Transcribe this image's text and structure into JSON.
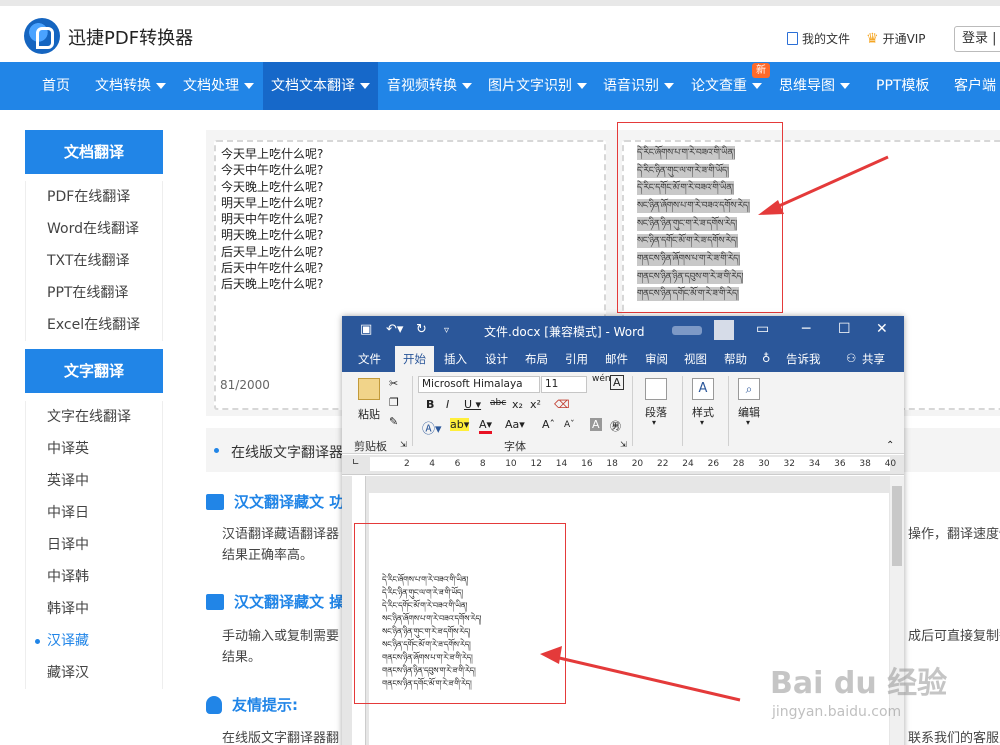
{
  "site": {
    "logo_text": "迅捷PDF转换器",
    "my_files": "我的文件",
    "vip": "开通VIP",
    "login": "登录 |"
  },
  "nav": {
    "items": [
      "首页",
      "文档转换",
      "文档处理",
      "文档文本翻译",
      "音视频转换",
      "图片文字识别",
      "语音识别",
      "论文查重",
      "思维导图",
      "PPT模板",
      "客户端"
    ],
    "new_badge": "新"
  },
  "sidebar": {
    "doc_head": "文档翻译",
    "doc_items": [
      "PDF在线翻译",
      "Word在线翻译",
      "TXT在线翻译",
      "PPT在线翻译",
      "Excel在线翻译"
    ],
    "text_head": "文字翻译",
    "text_items": [
      "文字在线翻译",
      "中译英",
      "英译中",
      "中译日",
      "日译中",
      "中译韩",
      "韩译中",
      "汉译藏",
      "藏译汉"
    ]
  },
  "translator": {
    "source_lines": [
      "今天早上吃什么呢?",
      "今天中午吃什么呢?",
      "今天晚上吃什么呢?",
      "明天早上吃什么呢?",
      "明天中午吃什么呢?",
      "明天晚上吃什么呢?",
      "后天早上吃什么呢?",
      "后天中午吃什么呢?",
      "后天晚上吃什么呢?"
    ],
    "counter": "81/2000",
    "result_lines": [
      "དེ་རིང་ཞོགས་པ་ག་རེ་བཟའ་གི་ཡིན།",
      "དེ་རིང་ཉིན་གུང་ལ་ག་རེ་ཟ་གི་ཡོད།",
      "དེ་རིང་དགོང་མོ་ག་རེ་བཟའ་གི་ཡིན།",
      "སང་ཉིན་ཞོགས་པ་ག་རེ་བཟའ་དགོས་རེད།",
      "སང་ཉིན་ཉིན་གུང་ག་རེ་ཟ་དགོས་རེད།",
      "སང་ཉིན་དགོང་མོ་ག་རེ་ཟ་དགོས་རེད།",
      "གནངས་ཉིན་ཞོགས་པ་ག་རེ་ཟ་གི་རེད།",
      "གནངས་ཉིན་ཉིན་དབུས་ག་རེ་ཟ་གི་རེད།",
      "གནངས་ཉིན་དགོང་མོ་ག་རེ་ཟ་གི་རེད།"
    ]
  },
  "article": {
    "bullet": "在线版文字翻译器",
    "sec1_title": "汉文翻译藏文 功",
    "sec1_p1": "汉语翻译藏语翻译器",
    "sec1_p1_right": "操作，翻译速度快",
    "sec1_p2": "结果正确率高。",
    "sec2_title": "汉文翻译藏文 操",
    "sec2_p1": "手动输入或复制需要",
    "sec2_p1_right": "成后可直接复制翻",
    "sec2_p2": "结果。",
    "sec3_title": "友情提示:",
    "sec3_p1": "在线版文字翻译器翻",
    "sec3_p1_right": "联系我们的客服人"
  },
  "word": {
    "title": "文件.docx [兼容模式] - Word",
    "tabs": [
      "文件",
      "开始",
      "插入",
      "设计",
      "布局",
      "引用",
      "邮件",
      "审阅",
      "视图",
      "帮助",
      "告诉我",
      "共享"
    ],
    "font_name": "Microsoft Himalaya",
    "font_size": "11",
    "paste": "粘贴",
    "clipboard": "剪贴板",
    "font_group": "字体",
    "paragraph": "段落",
    "styles": "样式",
    "editing": "编辑",
    "ruler": [
      "2",
      "4",
      "6",
      "8",
      "10",
      "12",
      "14",
      "16",
      "18",
      "20",
      "22",
      "24",
      "26",
      "28",
      "30",
      "32",
      "34",
      "36",
      "38",
      "40"
    ],
    "doc_lines": [
      "དེ་རིང་ཞོགས་པ་ག་རེ་བཟའ་གི་ཡིན།",
      "དེ་རིང་ཉིན་གུང་ལ་ག་རེ་ཟ་གི་ཡོད།",
      "དེ་རིང་དགོང་མོ་ག་རེ་བཟའ་གི་ཡིན།",
      "སང་ཉིན་ཞོགས་པ་ག་རེ་བཟའ་དགོས་རེད།",
      "སང་ཉིན་ཉིན་གུང་ག་རེ་ཟ་དགོས་རེད།",
      "སང་ཉིན་དགོང་མོ་ག་རེ་ཟ་དགོས་རེད།",
      "གནངས་ཉིན་ཞོགས་པ་ག་རེ་ཟ་གི་རེད།",
      "གནངས་ཉིན་ཉིན་དབུས་ག་རེ་ཟ་གི་རེད།",
      "གནངས་ཉིན་དགོང་མོ་ག་རེ་ཟ་གི་རེད།"
    ]
  },
  "watermark": {
    "main": "Bai du 经验",
    "sub": "jingyan.baidu.com"
  },
  "colors": {
    "brand_blue": "#2185e7",
    "word_blue": "#2b579a",
    "highlight_red": "#e43a3a"
  }
}
